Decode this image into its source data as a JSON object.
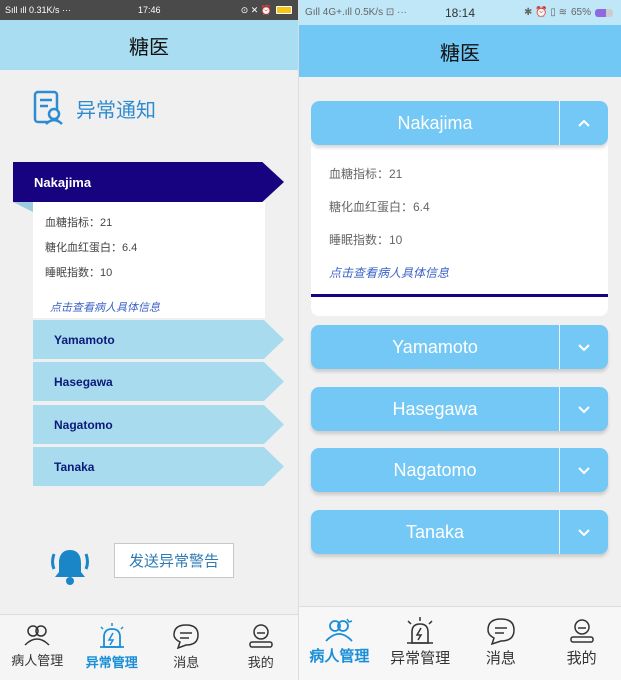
{
  "left": {
    "status": {
      "signal": "Sıll ıll 0.31K/s ···",
      "time": "17:46",
      "icons": "⊙ ✕ ⏰"
    },
    "header_title": "糖医",
    "notice_title": "异常通知",
    "active_patient": {
      "name": "Nakajima",
      "blood_sugar": "血糖指标：21",
      "hba1c": "糖化血红蛋白：6.4",
      "sleep": "睡眠指数：10",
      "link": "点击查看病人具体信息"
    },
    "patients": [
      "Yamamoto",
      "Hasegawa",
      "Nagatomo",
      "Tanaka"
    ],
    "send_button": "发送异常警告",
    "tabs": [
      {
        "label": "病人管理",
        "icon": "patients-icon"
      },
      {
        "label": "异常管理",
        "icon": "alarm-icon"
      },
      {
        "label": "消息",
        "icon": "message-icon"
      },
      {
        "label": "我的",
        "icon": "profile-icon"
      }
    ],
    "active_tab": 1
  },
  "right": {
    "status": {
      "signal": "Gıll 4G+.ıll 0.5K/s ⊡ ···",
      "time": "18:14",
      "battery": "65%"
    },
    "header_title": "糖医",
    "active_patient": {
      "name": "Nakajima",
      "blood_sugar": "血糖指标：21",
      "hba1c": "糖化血红蛋白：6.4",
      "sleep": "睡眠指数：10",
      "link": "点击查看病人具体信息"
    },
    "patients": [
      "Yamamoto",
      "Hasegawa",
      "Nagatomo",
      "Tanaka"
    ],
    "tabs": [
      {
        "label": "病人管理",
        "icon": "patients-icon"
      },
      {
        "label": "异常管理",
        "icon": "alarm-icon"
      },
      {
        "label": "消息",
        "icon": "message-icon"
      },
      {
        "label": "我的",
        "icon": "profile-icon"
      }
    ],
    "active_tab": 0
  },
  "colors": {
    "left_header": "#a9ddf1",
    "left_active_ribbon": "#17037f",
    "left_item": "#a9dbee",
    "right_header": "#71c8f5",
    "right_item": "#73c8f5",
    "accent_blue": "#1a8fd8",
    "link": "#3c63c7"
  }
}
